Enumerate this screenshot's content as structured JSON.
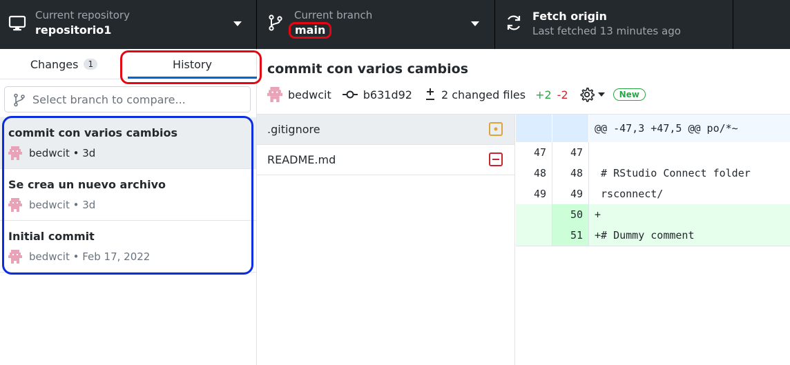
{
  "toolbar": {
    "repository": {
      "label": "Current repository",
      "value": "repositorio1"
    },
    "branch": {
      "label": "Current branch",
      "value": "main"
    },
    "fetch": {
      "title": "Fetch origin",
      "subtitle": "Last fetched 13 minutes ago"
    }
  },
  "sidebar": {
    "tabs": {
      "changes": "Changes",
      "changes_count": "1",
      "history": "History"
    },
    "compare_placeholder": "Select branch to compare...",
    "commits": [
      {
        "title": "commit con varios cambios",
        "meta": "bedwcit • 3d"
      },
      {
        "title": "Se crea un nuevo archivo",
        "meta": "bedwcit • 3d"
      },
      {
        "title": "Initial commit",
        "meta": "bedwcit • Feb 17, 2022"
      }
    ]
  },
  "commit": {
    "title": "commit con varios cambios",
    "author": "bedwcit",
    "sha": "b631d92",
    "changed_files": "2 changed files",
    "additions": "+2",
    "deletions": "-2",
    "badge": "New"
  },
  "files": [
    {
      "name": ".gitignore",
      "status": "modified"
    },
    {
      "name": "README.md",
      "status": "deleted"
    }
  ],
  "diff": {
    "hunk": "@@ -47,3 +47,5 @@ po/*~",
    "lines": [
      {
        "old": "47",
        "new": "47",
        "text": ""
      },
      {
        "old": "48",
        "new": "48",
        "text": " # RStudio Connect folder"
      },
      {
        "old": "49",
        "new": "49",
        "text": " rsconnect/"
      },
      {
        "old": "",
        "new": "50",
        "text": "+"
      },
      {
        "old": "",
        "new": "51",
        "text": "+# Dummy comment"
      }
    ]
  },
  "colors": {
    "toolbar_bg": "#24292e",
    "accent_blue": "#0366d6",
    "added": "#28a745",
    "removed": "#cb2431",
    "annotation_red": "#e30613",
    "annotation_blue": "#0a2de0"
  }
}
